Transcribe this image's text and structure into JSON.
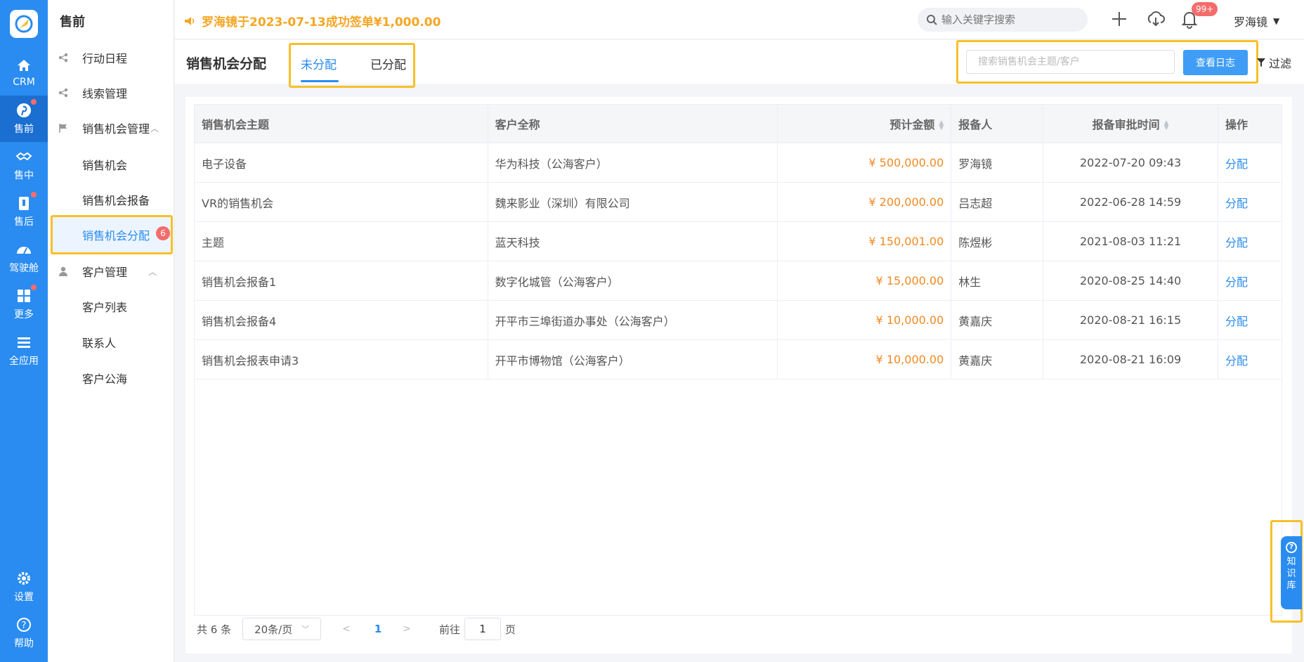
{
  "rail": {
    "items": [
      {
        "label": "CRM",
        "icon": "home-icon"
      },
      {
        "label": "售前",
        "icon": "pinterest-icon",
        "dot": true
      },
      {
        "label": "售中",
        "icon": "handshake-icon"
      },
      {
        "label": "售后",
        "icon": "clipboard-icon",
        "dot": true
      },
      {
        "label": "驾驶舱",
        "icon": "dashboard-icon"
      },
      {
        "label": "更多",
        "icon": "grid-icon",
        "dot": true
      },
      {
        "label": "全应用",
        "icon": "menu-icon"
      },
      {
        "label": "设置",
        "icon": "gear-icon"
      },
      {
        "label": "帮助",
        "icon": "help-icon"
      }
    ]
  },
  "subnav": {
    "title": "售前",
    "items": [
      {
        "label": "行动日程"
      },
      {
        "label": "线索管理"
      },
      {
        "label": "销售机会管理"
      },
      {
        "label": "销售机会"
      },
      {
        "label": "销售机会报备"
      },
      {
        "label": "销售机会分配",
        "badge": "6"
      },
      {
        "label": "客户管理"
      },
      {
        "label": "客户列表"
      },
      {
        "label": "联系人"
      },
      {
        "label": "客户公海"
      }
    ]
  },
  "topbar": {
    "notice": "罗海镜于2023-07-13成功签单¥1,000.00",
    "search_placeholder": "输入关键字搜索",
    "bell_badge": "99+",
    "user": "罗海镜"
  },
  "page": {
    "title": "销售机会分配",
    "tabs": [
      "未分配",
      "已分配"
    ],
    "search_placeholder": "搜索销售机会主题/客户",
    "log_button": "查看日志",
    "filter": "过滤"
  },
  "table": {
    "headers": [
      "销售机会主题",
      "客户全称",
      "预计金额",
      "报备人",
      "报备审批时间",
      "操作"
    ],
    "rows": [
      [
        "电子设备",
        "华为科技（公海客户）",
        "¥ 500,000.00",
        "罗海镜",
        "2022-07-20 09:43",
        "分配"
      ],
      [
        "VR的销售机会",
        "魏来影业（深圳）有限公司",
        "¥ 200,000.00",
        "吕志超",
        "2022-06-28 14:59",
        "分配"
      ],
      [
        "主题",
        "蓝天科技",
        "¥ 150,001.00",
        "陈煜彬",
        "2021-08-03 11:21",
        "分配"
      ],
      [
        "销售机会报备1",
        "数字化城管（公海客户）",
        "¥ 15,000.00",
        "林生",
        "2020-08-25 14:40",
        "分配"
      ],
      [
        "销售机会报备4",
        "开平市三埠街道办事处（公海客户）",
        "¥ 10,000.00",
        "黄嘉庆",
        "2020-08-21 16:15",
        "分配"
      ],
      [
        "销售机会报表申请3",
        "开平市博物馆（公海客户）",
        "¥ 10,000.00",
        "黄嘉庆",
        "2020-08-21 16:09",
        "分配"
      ]
    ]
  },
  "pager": {
    "total": "共 6 条",
    "page_size": "20条/页",
    "current": "1",
    "goto_label": "前往",
    "goto_value": "1",
    "page_unit": "页"
  },
  "kb": {
    "chars": [
      "知",
      "识",
      "库"
    ]
  },
  "colors": {
    "primary": "#2a8cf0",
    "amount": "#f08a24",
    "highlight": "#f7c02a",
    "badge": "#f56c6c"
  }
}
